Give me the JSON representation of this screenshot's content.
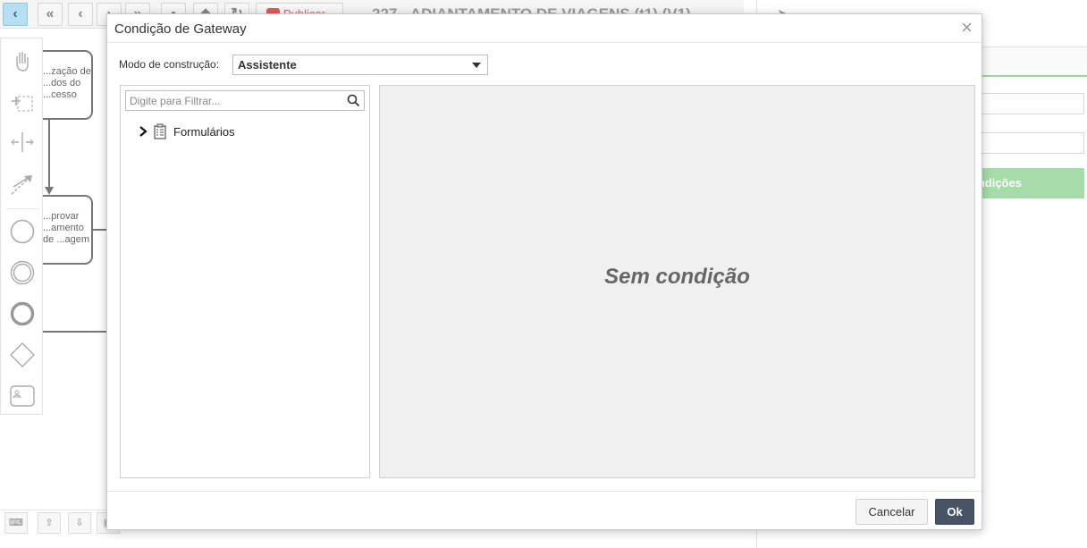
{
  "editor": {
    "publish_label": "Publicar",
    "process_title": "227 - ADIANTAMENTO DE VIAGENS (t1) (V1)",
    "tasks": [
      {
        "label": "...zação de ...dos do ...cesso"
      },
      {
        "label": "...provar ...amento de ...agem"
      }
    ],
    "right_panel_button_label": "...ndições"
  },
  "dialog": {
    "title": "Condição de Gateway",
    "close_glyph": "×",
    "mode_label": "Modo de construção:",
    "mode_value": "Assistente",
    "filter_placeholder": "Digite para Filtrar...",
    "tree": [
      {
        "label": "Formulários",
        "icon": "form-icon",
        "expanded": false
      }
    ],
    "empty_message": "Sem condição",
    "cancel_label": "Cancelar",
    "ok_label": "Ok"
  },
  "colors": {
    "active_tool": "#b8def2",
    "ok_button": "#475466",
    "right_panel_button": "#a5dca9",
    "publish": "#e25a5a"
  }
}
